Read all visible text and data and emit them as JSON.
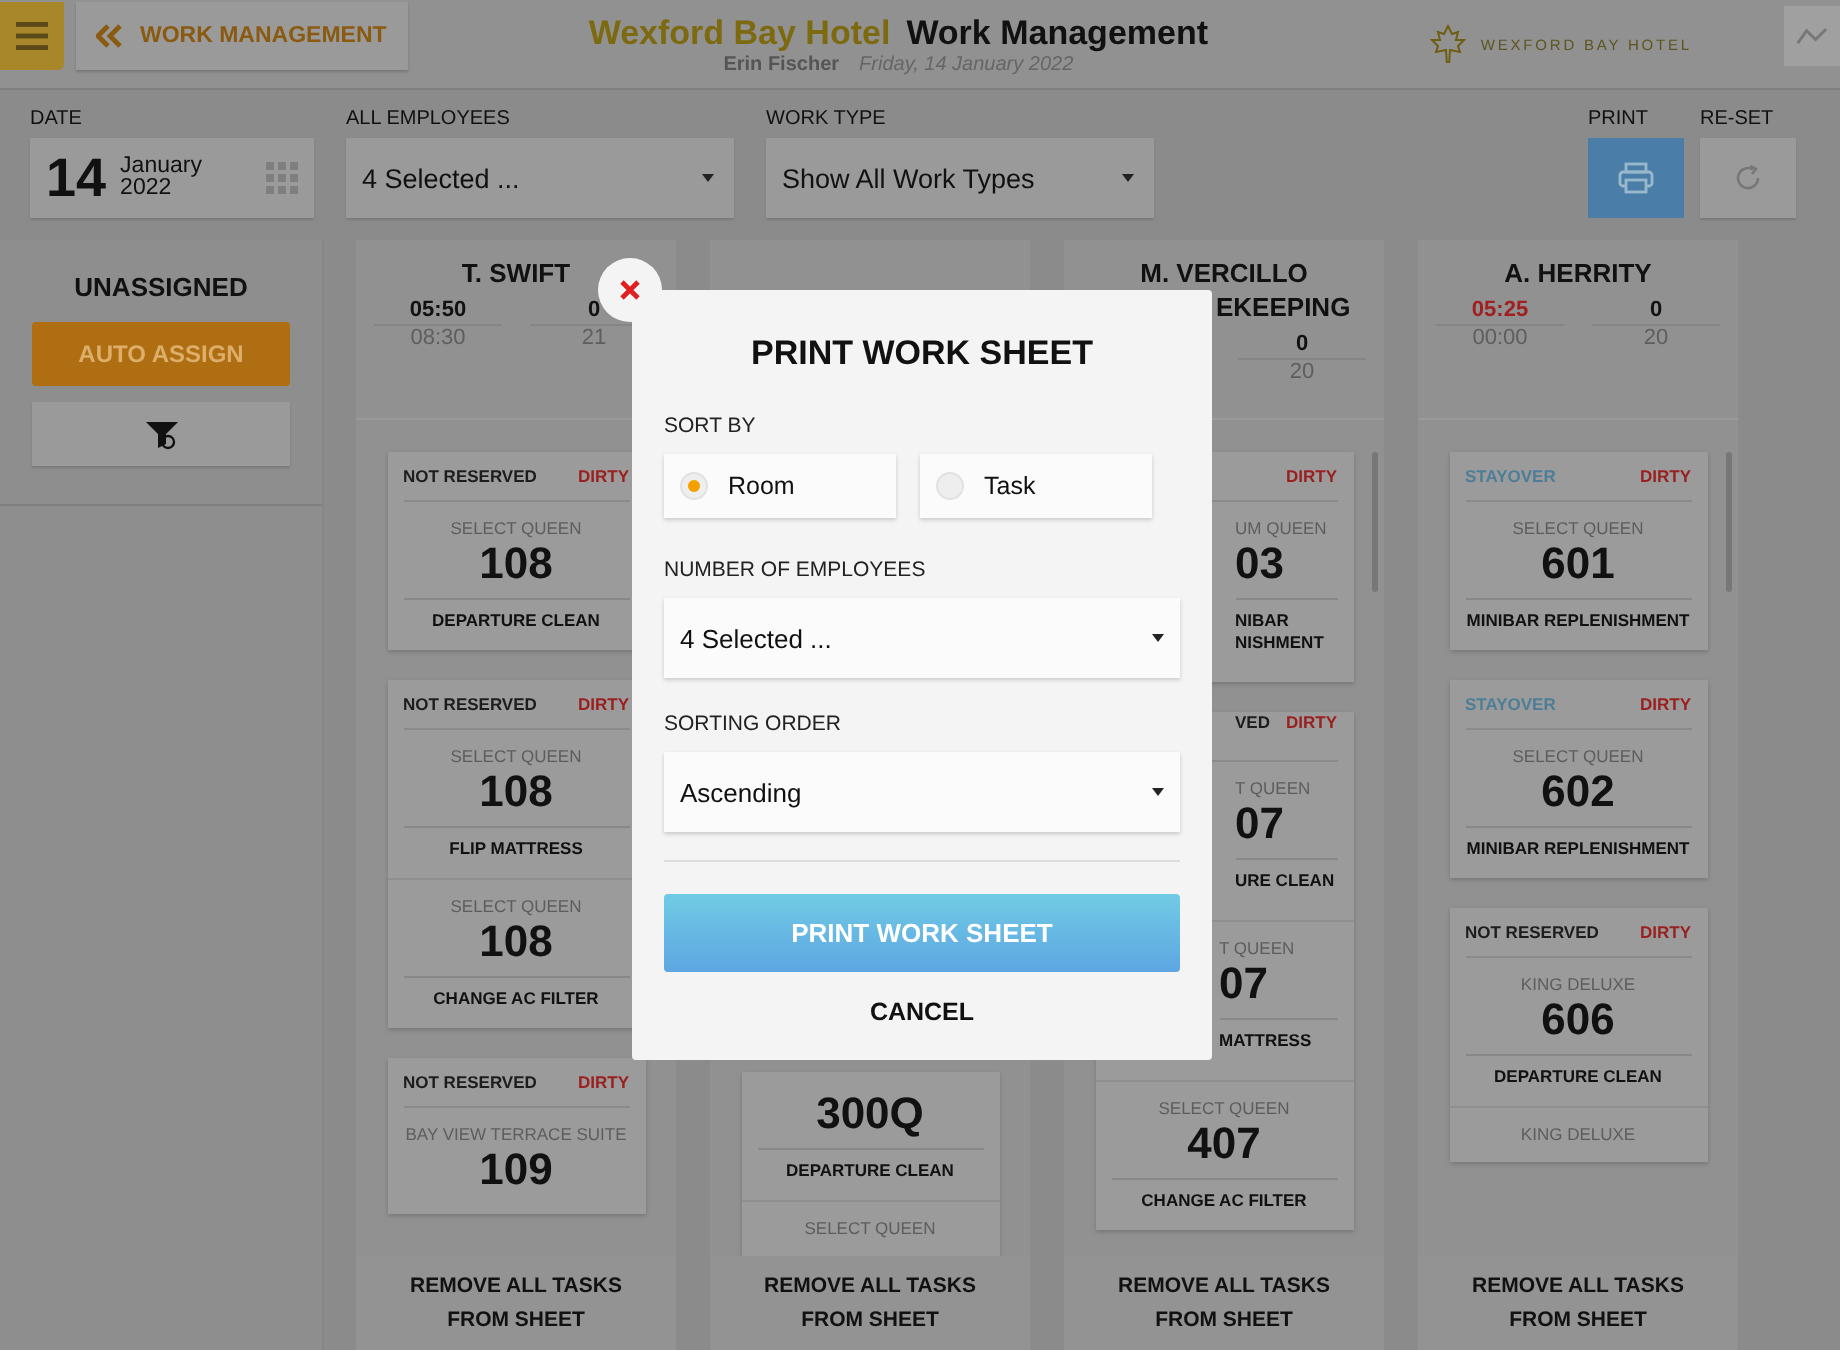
{
  "header": {
    "back_label": "WORK MANAGEMENT",
    "hotel_name": "Wexford Bay Hotel",
    "page_title": "Work Management",
    "user": "Erin Fischer",
    "date": "Friday, 14 January 2022",
    "logo_text": "WEXFORD BAY HOTEL"
  },
  "filters": {
    "date_label": "DATE",
    "day": "14",
    "month": "January",
    "year": "2022",
    "employees_label": "ALL EMPLOYEES",
    "employees_value": "4 Selected ...",
    "work_type_label": "WORK TYPE",
    "work_type_value": "Show All Work Types",
    "print_label": "PRINT",
    "reset_label": "RE-SET"
  },
  "unassigned": {
    "title": "UNASSIGNED",
    "auto_assign": "AUTO ASSIGN"
  },
  "columns": [
    {
      "kind": "open",
      "name": "T. SWIFT",
      "scrollbar": false,
      "stats": [
        {
          "value": "05:50",
          "total": "08:30",
          "overdue": false
        },
        {
          "value": "0",
          "total": "21",
          "overdue": false
        }
      ],
      "cards": [
        {
          "kind": "not-reserved",
          "status": "NOT RESERVED",
          "condition": "DIRTY",
          "tasks": [
            {
              "kind": "full",
              "room_type": "SELECT QUEEN",
              "room": "108",
              "task": "DEPARTURE CLEAN"
            }
          ]
        },
        {
          "kind": "not-reserved",
          "status": "NOT RESERVED",
          "condition": "DIRTY",
          "tasks": [
            {
              "kind": "full",
              "room_type": "SELECT QUEEN",
              "room": "108",
              "task": "FLIP MATTRESS"
            },
            {
              "kind": "full",
              "room_type": "SELECT QUEEN",
              "room": "108",
              "task": "CHANGE AC FILTER"
            }
          ]
        },
        {
          "kind": "not-reserved",
          "status": "NOT RESERVED",
          "condition": "DIRTY",
          "tasks": [
            {
              "kind": "full",
              "room_type": "BAY VIEW TERRACE SUITE",
              "room": "109"
            }
          ]
        }
      ],
      "footer": "REMOVE ALL TASKS FROM SHEET"
    },
    {
      "kind": "below",
      "scrollbar": false,
      "cards": [
        {
          "tasks": [
            {
              "kind": "full",
              "room": "300Q",
              "task": "DEPARTURE CLEAN"
            },
            {
              "kind": "full",
              "room_type": "SELECT QUEEN"
            }
          ]
        }
      ],
      "footer": "REMOVE ALL TASKS FROM SHEET"
    },
    {
      "kind": "clipped",
      "name": "M. VERCILLO",
      "name_line2": "EKEEPING",
      "scrollbar": true,
      "stats": [
        {
          "value": "0",
          "total": "20",
          "overdue": false
        }
      ],
      "cards": [
        {
          "condition": "DIRTY",
          "tasks": [
            {
              "kind": "clipped",
              "room_type": "UM QUEEN",
              "room": "03",
              "task_lines": [
                "NIBAR",
                "NISHMENT"
              ]
            }
          ]
        },
        {
          "kind": "not-reserved",
          "status": "VED",
          "clipped": true,
          "condition": "DIRTY",
          "tasks": [
            {
              "kind": "clipped",
              "room_type": "T QUEEN",
              "room": "07",
              "task_lines": [
                "URE CLEAN"
              ]
            },
            {
              "kind": "clipped",
              "room_type": "T QUEEN",
              "room": "07",
              "task_lines": [
                "MATTRESS"
              ]
            },
            {
              "kind": "full",
              "room_type": "SELECT QUEEN",
              "room": "407",
              "task": "CHANGE AC FILTER"
            }
          ]
        }
      ],
      "footer": "REMOVE ALL TASKS FROM SHEET"
    },
    {
      "kind": "open",
      "name": "A. HERRITY",
      "scrollbar": true,
      "stats": [
        {
          "value": "05:25",
          "total": "00:00",
          "overdue": true
        },
        {
          "value": "0",
          "total": "20",
          "overdue": false
        }
      ],
      "cards": [
        {
          "kind": "stayover",
          "status": "STAYOVER",
          "condition": "DIRTY",
          "tasks": [
            {
              "kind": "full",
              "room_type": "SELECT QUEEN",
              "room": "601",
              "task": "MINIBAR REPLENISHMENT"
            }
          ]
        },
        {
          "kind": "stayover",
          "status": "STAYOVER",
          "condition": "DIRTY",
          "tasks": [
            {
              "kind": "full",
              "room_type": "SELECT QUEEN",
              "room": "602",
              "task": "MINIBAR REPLENISHMENT"
            }
          ]
        },
        {
          "kind": "not-reserved",
          "status": "NOT RESERVED",
          "condition": "DIRTY",
          "tasks": [
            {
              "kind": "full",
              "room_type": "KING DELUXE",
              "room": "606",
              "task": "DEPARTURE CLEAN"
            },
            {
              "kind": "full",
              "room_type": "KING DELUXE"
            }
          ]
        }
      ],
      "footer": "REMOVE ALL TASKS FROM SHEET"
    }
  ],
  "dialog": {
    "title": "PRINT WORK SHEET",
    "sort_label": "SORT BY",
    "sort_options": [
      {
        "label": "Room",
        "selected": true
      },
      {
        "label": "Task",
        "selected": false
      }
    ],
    "employees_label": "NUMBER OF EMPLOYEES",
    "employees_value": "4 Selected ...",
    "order_label": "SORTING ORDER",
    "order_value": "Ascending",
    "print_button": "PRINT WORK SHEET",
    "cancel": "CANCEL"
  }
}
